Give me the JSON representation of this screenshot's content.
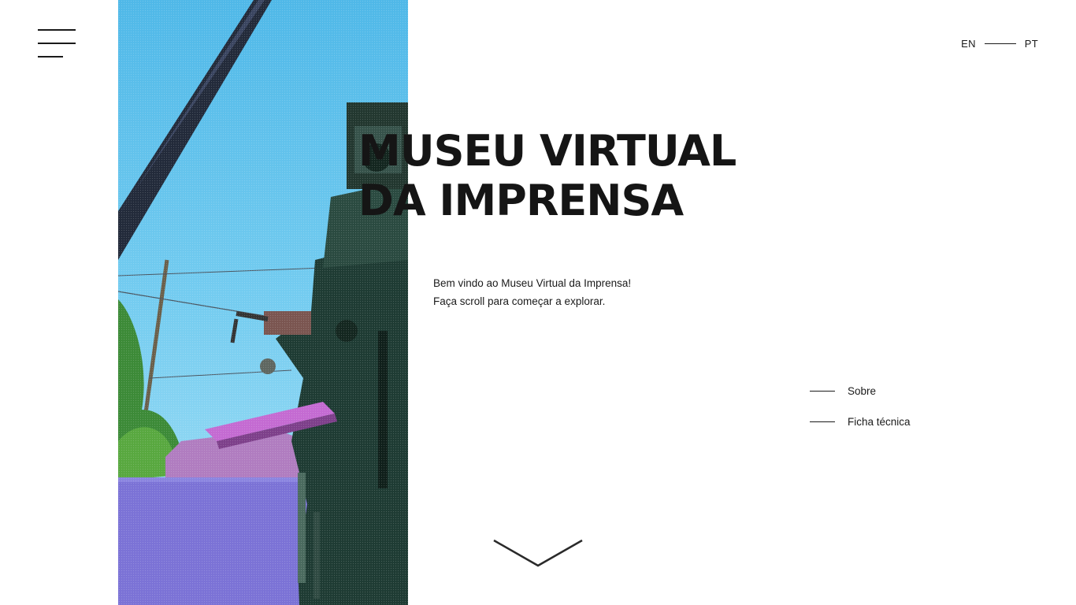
{
  "header": {
    "menu_icon": "hamburger-menu-icon",
    "languages": [
      {
        "code": "EN"
      },
      {
        "code": "PT"
      }
    ]
  },
  "hero": {
    "title_line1": "MUSEU VIRTUAL",
    "title_line2": "DA IMPRENSA",
    "intro_line1": "Bem vindo ao Museu Virtual da Imprensa!",
    "intro_line2": "Faça scroll para começar a explorar.",
    "image_subject": "printing-press-photo",
    "scroll_icon": "chevron-down-icon"
  },
  "side_nav": {
    "items": [
      {
        "label": "Sobre"
      },
      {
        "label": "Ficha técnica"
      }
    ]
  },
  "colors": {
    "text": "#1a1a1a",
    "background": "#ffffff",
    "sky": "#6cc6ec",
    "ground": "#7b72d6",
    "press": "#1e3b33",
    "foliage": "#55a33c"
  }
}
